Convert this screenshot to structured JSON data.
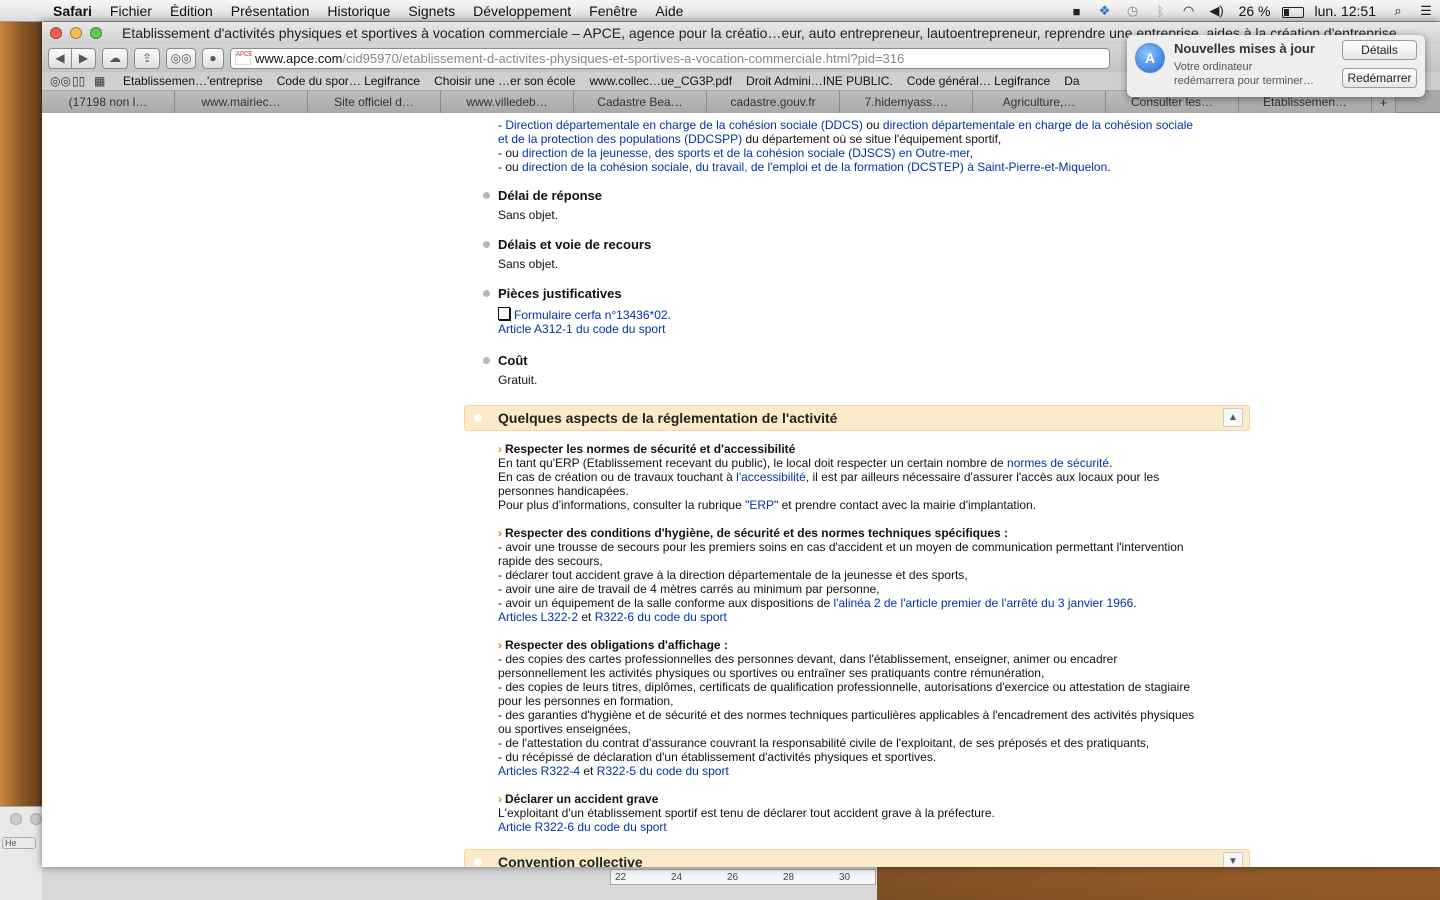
{
  "menubar": {
    "app": "Safari",
    "items": [
      "Fichier",
      "Édition",
      "Présentation",
      "Historique",
      "Signets",
      "Développement",
      "Fenêtre",
      "Aide"
    ],
    "battery": "26 %",
    "clock": "lun. 12:51"
  },
  "window": {
    "title": "Etablissement d'activités physiques et sportives à vocation commerciale – APCE, agence pour la créatio…eur, auto entrepreneur, lautoentrepreneur, reprendre une entreprise, aides à la création d'entreprise",
    "url_host": "www.apce.com",
    "url_path": "/cid95970/etablissement-d-activites-physiques-et-sportives-a-vocation-commerciale.html?pid=316",
    "favicon_text": "APCE"
  },
  "bookmarks": [
    "Etablissemen…'entreprise",
    "Code du spor… Legifrance",
    "Choisir une …er son école",
    "www.collec…ue_CG3P.pdf",
    "Droit Admini…INE PUBLIC.",
    "Code général… Legifrance",
    "Da"
  ],
  "tabs": [
    "(17198 non l…",
    "www.mairiec…",
    "Site officiel d…",
    "www.villedeb…",
    "Cadastre Bea…",
    "cadastre.gouv.fr",
    "7.hidemyass….",
    "Agriculture,…",
    "Consulter les…",
    "Etablissemen…"
  ],
  "notification": {
    "title": "Nouvelles mises à jour",
    "body_line1": "Votre ordinateur",
    "body_line2": "redémarrera pour terminer…",
    "btn_details": "Détails",
    "btn_restart": "Redémarrer"
  },
  "content": {
    "top": {
      "l1_a": "- ",
      "l1_link1": "Direction départementale en charge de la cohésion sociale (DDCS)",
      "l1_b": " ou ",
      "l1_link2": "direction départementale en charge de la cohésion sociale",
      "l2_link": "et de la protection des populations (DDCSPP)",
      "l2_b": " du département où se situe l'équipement sportif,",
      "l3_a": "- ou ",
      "l3_link": "direction de la jeunesse, des sports et de la cohésion sociale (DJSCS) en Outre-mer",
      "l3_b": ",",
      "l4_a": "- ou ",
      "l4_link": "direction de la cohésion sociale, du travail, de l'emploi et de la formation (DCSTEP) à Saint-Pierre-et-Miquelon",
      "l4_b": "."
    },
    "delai_title": "Délai de réponse",
    "delai_value": "Sans objet.",
    "recours_title": "Délais et voie de recours",
    "recours_value": "Sans objet.",
    "pieces_title": "Pièces justificatives",
    "pieces_link1": "Formulaire cerfa n°13436*02.",
    "pieces_link2": "Article A312-1 du code du sport",
    "cout_title": "Coût",
    "cout_value": "Gratuit.",
    "section_title": "Quelques aspects de la réglementation de l'activité",
    "s1_title": "Respecter les normes de sécurité et d'accessibilité",
    "s1_l1_a": "En tant qu'ERP (Etablissement recevant du public), le local doit respecter un certain nombre de ",
    "s1_l1_link": "normes de sécurité",
    "s1_l1_b": ".",
    "s1_l2_a": "En cas de création ou de travaux touchant à ",
    "s1_l2_link": "l'accessibilité",
    "s1_l2_b": ", il est par ailleurs nécessaire d'assurer l'accès aux locaux pour les",
    "s1_l3": "personnes handicapées.",
    "s1_l4_a": "Pour plus d'informations, consulter la rubrique \"",
    "s1_l4_link": "ERP",
    "s1_l4_b": "\" et prendre contact avec la mairie d'implantation.",
    "s2_title": "Respecter des conditions d'hygiène, de sécurité et des normes techniques spécifiques :",
    "s2_l1": "- avoir une trousse de secours pour les premiers soins en cas d'accident et un moyen de communication permettant l'intervention",
    "s2_l2": "rapide des secours,",
    "s2_l3": "- déclarer tout accident grave à la direction départementale de la jeunesse et des sports,",
    "s2_l4": "- avoir une aire de travail de 4 mètres carrés au minimum par personne,",
    "s2_l5_a": "- avoir un équipement de la salle conforme aux dispositions de ",
    "s2_l5_link": "l'alinéa 2 de l'article premier de l'arrêté du 3 janvier 1966",
    "s2_l5_b": ".",
    "s2_l6_link1": "Articles L322-2",
    "s2_l6_mid": " et ",
    "s2_l6_link2": "R322-6 du code du sport",
    "s3_title": "Respecter des obligations d'affichage :",
    "s3_l1": "- des copies des cartes professionnelles des personnes devant, dans l'établissement, enseigner, animer ou encadrer",
    "s3_l2": "personnellement les activités physiques ou sportives ou entraîner ses pratiquants contre rémunération,",
    "s3_l3": "- des copies de leurs titres, diplômes, certificats de qualification professionnelle, autorisations d'exercice ou attestation de stagiaire",
    "s3_l4": "pour les personnes en formation,",
    "s3_l5": "- des garanties d'hygiène et de sécurité et des normes techniques particulières applicables à l'encadrement des activités physiques",
    "s3_l6": "ou sportives enseignées,",
    "s3_l7": "- de l'attestation du contrat d'assurance couvrant la responsabilité civile de l'exploitant, de ses préposés et des pratiquants,",
    "s3_l8": "- du récépissé de déclaration d'un établissement d'activités physiques et sportives.",
    "s3_l9_link1": "Articles R322-4",
    "s3_l9_mid": " et ",
    "s3_l9_link2": "R322-5 du code du sport",
    "s4_title": "Déclarer un accident grave",
    "s4_l1": "L'exploitant d'un établissement sportif est tenu de déclarer tout accident grave à la préfecture.",
    "s4_l2_link": "Article R322-6 du code du sport",
    "section2_title": "Convention collective"
  },
  "background": {
    "left_window_text_1": "He",
    "ruler_ticks": [
      "22",
      "24",
      "26",
      "28",
      "30"
    ]
  }
}
